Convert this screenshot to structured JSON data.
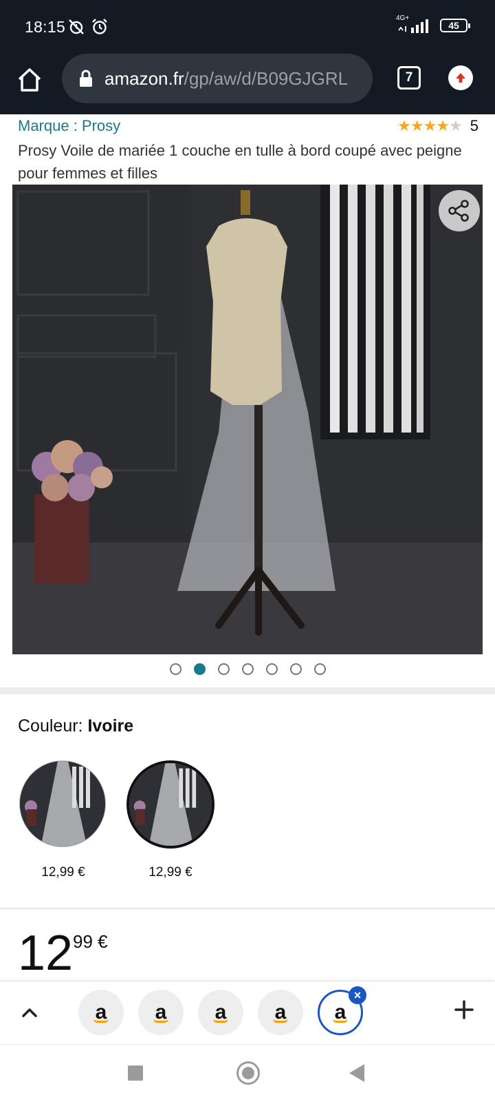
{
  "status_bar": {
    "time": "18:15",
    "network": "4G+",
    "battery": "45",
    "icons": [
      "alarm-off-icon",
      "alarm-icon",
      "signal-icon",
      "battery-icon"
    ]
  },
  "browser": {
    "url_host": "amazon.fr",
    "url_path": "/gp/aw/d/B09GJGRL",
    "tab_count": "7"
  },
  "product": {
    "brand_link": "Marque : Prosy",
    "rating_count": "5",
    "rating_stars": 4,
    "title": "Prosy Voile de mariée 1 couche en tulle à bord coupé avec peigne pour femmes et filles"
  },
  "gallery": {
    "dot_count": 7,
    "active_dot": 1
  },
  "variation": {
    "label": "Couleur: ",
    "selected_value": "Ivoire",
    "swatches": [
      {
        "price": "12,99 €",
        "selected": false
      },
      {
        "price": "12,99 €",
        "selected": true
      }
    ]
  },
  "price": {
    "whole": "12",
    "fraction": "99 €"
  },
  "tab_strip": {
    "tabs": [
      {
        "label": "a"
      },
      {
        "label": "a"
      },
      {
        "label": "a"
      },
      {
        "label": "a"
      },
      {
        "label": "a"
      }
    ],
    "close_glyph": "×"
  },
  "colors": {
    "chrome_bg": "#121a23",
    "link_teal": "#1b7a8a",
    "star_gold": "#f5a623",
    "tab_blue": "#1a56c4"
  }
}
